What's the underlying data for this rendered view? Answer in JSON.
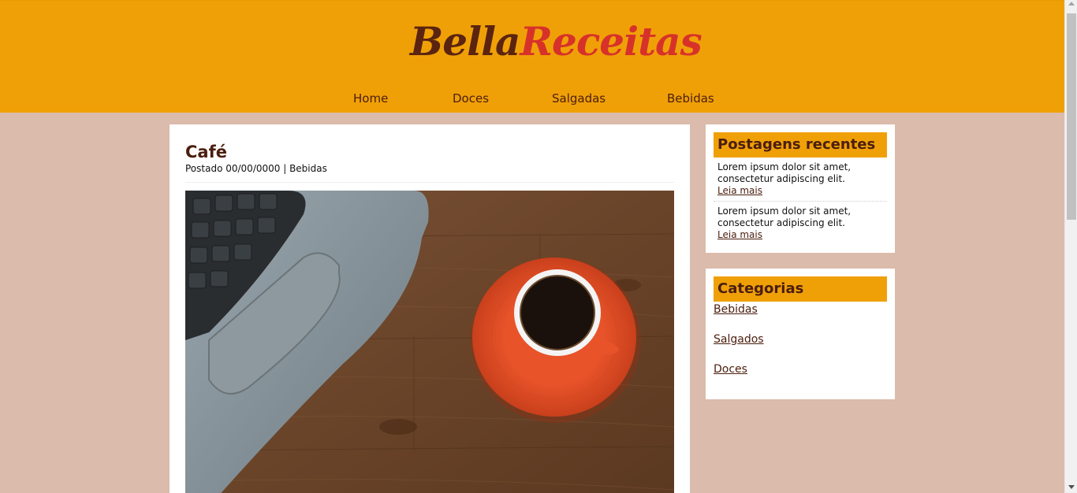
{
  "header": {
    "logo_part1": "Bella",
    "logo_part2": "Receitas",
    "nav": [
      "Home",
      "Doces",
      "Salgadas",
      "Bebidas"
    ]
  },
  "post": {
    "title": "Café",
    "meta": "Postado 00/00/0000 | Bebidas"
  },
  "sidebar": {
    "recent_title": "Postagens recentes",
    "recent_posts": [
      {
        "text": "Lorem ipsum dolor sit amet, consectetur adipiscing elit.",
        "more": "Leia mais"
      },
      {
        "text": "Lorem ipsum dolor sit amet, consectetur adipiscing elit.",
        "more": "Leia mais"
      }
    ],
    "categories_title": "Categorias",
    "categories": [
      "Bebidas",
      "Salgados",
      "Doces"
    ]
  },
  "colors": {
    "header_bg": "#f0a007",
    "page_bg": "#dbbbab",
    "brand_dark": "#5a2410",
    "brand_red": "#d7322a",
    "saucer": "#e8532a"
  }
}
